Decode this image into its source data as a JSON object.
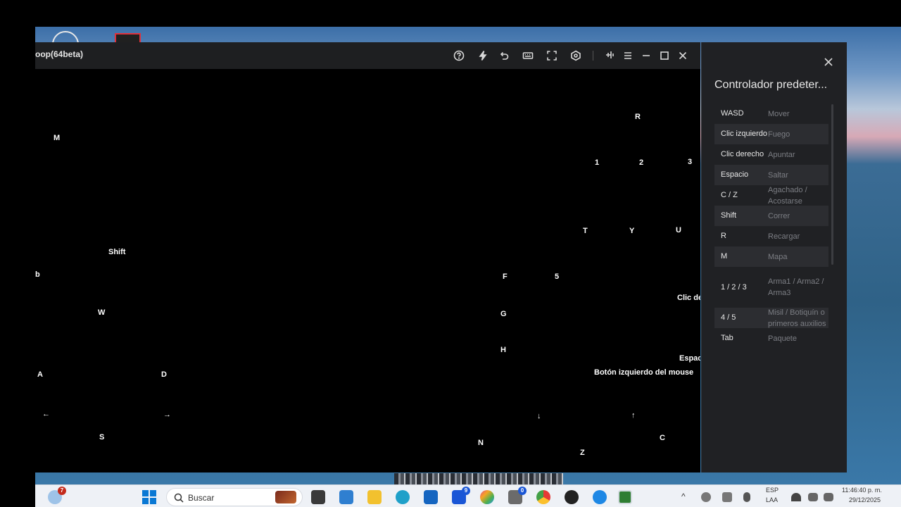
{
  "window": {
    "title": "oop(64beta)"
  },
  "toolbar": {
    "icons": [
      "help-icon",
      "lightning-icon",
      "undo-icon",
      "keyboard-icon",
      "fullscreen-icon",
      "gamepad-icon",
      "pin-icon",
      "menu-icon",
      "minimize-icon",
      "maximize-icon",
      "close-icon"
    ]
  },
  "overlay_keys": {
    "r": "R",
    "m": "M",
    "k1": "1",
    "k2": "2",
    "k3": "3",
    "t": "T",
    "y": "Y",
    "u": "U",
    "shift": "Shift",
    "b": "b",
    "f": "F",
    "k5": "5",
    "clic": "Clic de",
    "w": "W",
    "g": "G",
    "h": "H",
    "espacio": "Espac",
    "boton_izq": "Botón izquierdo del mouse",
    "a": "A",
    "d": "D",
    "left": "←",
    "right": "→",
    "down": "↓",
    "up": "↑",
    "s": "S",
    "n": "N",
    "c": "C",
    "z": "Z"
  },
  "panel": {
    "title": "Controlador predeter...",
    "mappings": [
      {
        "key": "WASD",
        "action": "Mover"
      },
      {
        "key": "Clic izquierdo",
        "action": "Fuego"
      },
      {
        "key": "Clic derecho",
        "action": "Apuntar"
      },
      {
        "key": "Espacio",
        "action": "Saltar"
      },
      {
        "key": "C / Z",
        "action": "Agachado / Acostarse"
      },
      {
        "key": "Shift",
        "action": "Correr"
      },
      {
        "key": "R",
        "action": "Recargar"
      },
      {
        "key": "M",
        "action": "Mapa"
      },
      {
        "key": "1 / 2 / 3",
        "action": "Arma1 / Arma2 / Arma3"
      },
      {
        "key": "4 / 5",
        "action": "Misil / Botiquín o primeros auxilios"
      },
      {
        "key": "Tab",
        "action": "Paquete"
      }
    ]
  },
  "taskbar": {
    "weather_badge": "7",
    "search_placeholder": "Buscar",
    "app_badge_1": "9",
    "app_badge_2": "0",
    "lang_1": "ESP",
    "lang_2": "LAA",
    "time": "11:46:40 p. m.",
    "date": "29/12/2025"
  },
  "colors": {
    "titlebar": "#1e1f21",
    "panel": "#202124",
    "row_alt": "#2c2d31",
    "action_text": "#7c7e84",
    "taskbar": "#eef1f6"
  }
}
